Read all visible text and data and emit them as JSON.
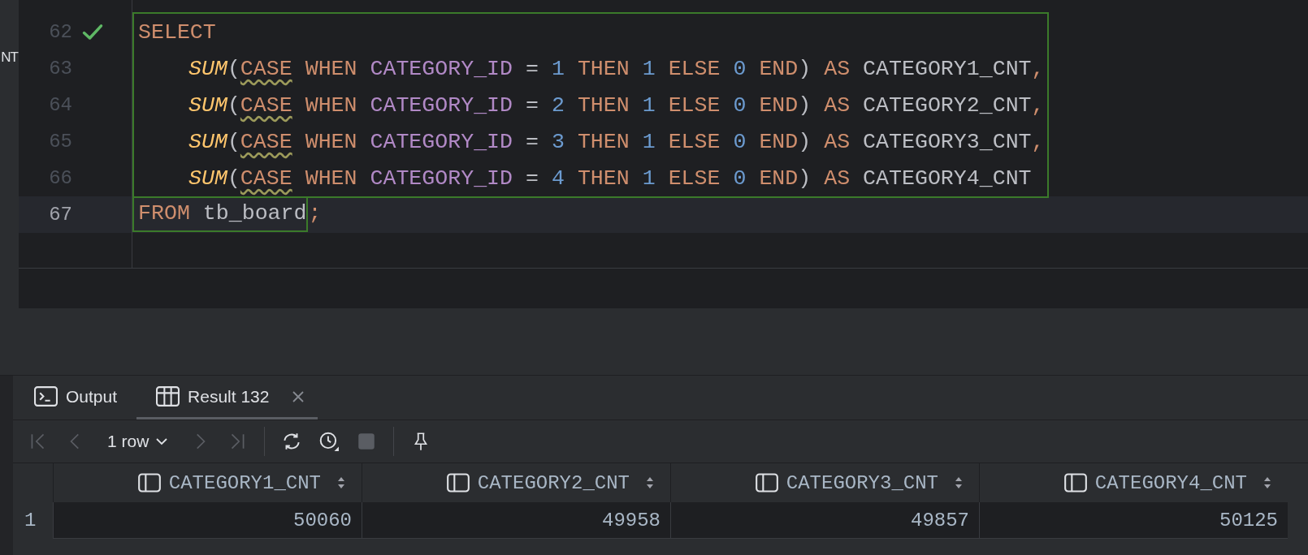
{
  "side_strip": {
    "text": "NT"
  },
  "editor": {
    "lines": [
      {
        "number": "62",
        "passed": true,
        "current": false,
        "selected": true,
        "tokens": [
          {
            "text": "SELECT",
            "kind": "keyword"
          }
        ]
      },
      {
        "number": "63",
        "passed": false,
        "current": false,
        "selected": true,
        "indented": true,
        "tokens": [
          {
            "text": "SUM",
            "kind": "function"
          },
          {
            "text": "(",
            "kind": "open"
          },
          {
            "text": "CASE",
            "kind": "keyword",
            "warn": true
          },
          {
            "text": "WHEN",
            "kind": "keyword"
          },
          {
            "text": "CATEGORY_ID",
            "kind": "ident"
          },
          {
            "text": "=",
            "kind": "op"
          },
          {
            "text": "1",
            "kind": "number"
          },
          {
            "text": "THEN",
            "kind": "keyword"
          },
          {
            "text": "1",
            "kind": "number"
          },
          {
            "text": "ELSE",
            "kind": "keyword"
          },
          {
            "text": "0",
            "kind": "number"
          },
          {
            "text": "END",
            "kind": "keyword"
          },
          {
            "text": ")",
            "kind": "close"
          },
          {
            "text": "AS",
            "kind": "keyword"
          },
          {
            "text": "CATEGORY1_CNT",
            "kind": "alias"
          },
          {
            "text": ",",
            "kind": "sep"
          }
        ]
      },
      {
        "number": "64",
        "passed": false,
        "current": false,
        "selected": true,
        "indented": true,
        "tokens": [
          {
            "text": "SUM",
            "kind": "function"
          },
          {
            "text": "(",
            "kind": "open"
          },
          {
            "text": "CASE",
            "kind": "keyword",
            "warn": true
          },
          {
            "text": "WHEN",
            "kind": "keyword"
          },
          {
            "text": "CATEGORY_ID",
            "kind": "ident"
          },
          {
            "text": "=",
            "kind": "op"
          },
          {
            "text": "2",
            "kind": "number"
          },
          {
            "text": "THEN",
            "kind": "keyword"
          },
          {
            "text": "1",
            "kind": "number"
          },
          {
            "text": "ELSE",
            "kind": "keyword"
          },
          {
            "text": "0",
            "kind": "number"
          },
          {
            "text": "END",
            "kind": "keyword"
          },
          {
            "text": ")",
            "kind": "close"
          },
          {
            "text": "AS",
            "kind": "keyword"
          },
          {
            "text": "CATEGORY2_CNT",
            "kind": "alias"
          },
          {
            "text": ",",
            "kind": "sep"
          }
        ]
      },
      {
        "number": "65",
        "passed": false,
        "current": false,
        "selected": true,
        "indented": true,
        "tokens": [
          {
            "text": "SUM",
            "kind": "function"
          },
          {
            "text": "(",
            "kind": "open"
          },
          {
            "text": "CASE",
            "kind": "keyword",
            "warn": true
          },
          {
            "text": "WHEN",
            "kind": "keyword"
          },
          {
            "text": "CATEGORY_ID",
            "kind": "ident"
          },
          {
            "text": "=",
            "kind": "op"
          },
          {
            "text": "3",
            "kind": "number"
          },
          {
            "text": "THEN",
            "kind": "keyword"
          },
          {
            "text": "1",
            "kind": "number"
          },
          {
            "text": "ELSE",
            "kind": "keyword"
          },
          {
            "text": "0",
            "kind": "number"
          },
          {
            "text": "END",
            "kind": "keyword"
          },
          {
            "text": ")",
            "kind": "close"
          },
          {
            "text": "AS",
            "kind": "keyword"
          },
          {
            "text": "CATEGORY3_CNT",
            "kind": "alias"
          },
          {
            "text": ",",
            "kind": "sep"
          }
        ]
      },
      {
        "number": "66",
        "passed": false,
        "current": false,
        "selected": true,
        "indented": true,
        "tokens": [
          {
            "text": "SUM",
            "kind": "function"
          },
          {
            "text": "(",
            "kind": "open"
          },
          {
            "text": "CASE",
            "kind": "keyword",
            "warn": true
          },
          {
            "text": "WHEN",
            "kind": "keyword"
          },
          {
            "text": "CATEGORY_ID",
            "kind": "ident"
          },
          {
            "text": "=",
            "kind": "op"
          },
          {
            "text": "4",
            "kind": "number"
          },
          {
            "text": "THEN",
            "kind": "keyword"
          },
          {
            "text": "1",
            "kind": "number"
          },
          {
            "text": "ELSE",
            "kind": "keyword"
          },
          {
            "text": "0",
            "kind": "number"
          },
          {
            "text": "END",
            "kind": "keyword"
          },
          {
            "text": ")",
            "kind": "close"
          },
          {
            "text": "AS",
            "kind": "keyword"
          },
          {
            "text": "CATEGORY4_CNT",
            "kind": "alias"
          }
        ]
      },
      {
        "number": "67",
        "passed": false,
        "current": true,
        "selected": true,
        "tokens": [
          {
            "text": "FROM",
            "kind": "keyword"
          },
          {
            "text": "tb_board",
            "kind": "alias"
          },
          {
            "text": ";",
            "kind": "sep",
            "outside": true
          }
        ]
      }
    ]
  },
  "results": {
    "tabs": [
      {
        "label": "Output",
        "kind": "console",
        "selected": false,
        "closable": false
      },
      {
        "label": "Result 132",
        "kind": "table",
        "selected": true,
        "closable": true
      }
    ],
    "toolbar": [
      {
        "kind": "first",
        "disabled": true
      },
      {
        "kind": "prev",
        "disabled": true
      },
      {
        "kind": "rows",
        "label": "1 row",
        "disabled": false
      },
      {
        "kind": "next",
        "disabled": true
      },
      {
        "kind": "last",
        "disabled": true
      },
      {
        "kind": "separator"
      },
      {
        "kind": "refresh",
        "disabled": false
      },
      {
        "kind": "history",
        "disabled": false
      },
      {
        "kind": "stop",
        "disabled": true
      },
      {
        "kind": "separator"
      },
      {
        "kind": "pin",
        "disabled": false
      }
    ],
    "table": {
      "columns": [
        "CATEGORY1_CNT",
        "CATEGORY2_CNT",
        "CATEGORY3_CNT",
        "CATEGORY4_CNT"
      ],
      "rows": [
        {
          "number": "1",
          "cells": [
            "50060",
            "49958",
            "49857",
            "50125"
          ]
        }
      ]
    }
  }
}
